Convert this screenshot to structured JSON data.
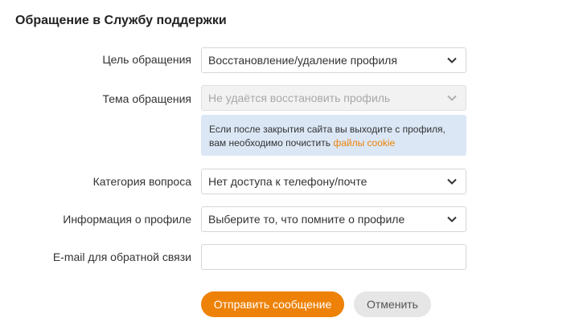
{
  "page": {
    "title": "Обращение в Службу поддержки"
  },
  "form": {
    "purpose": {
      "label": "Цель обращения",
      "value": "Восстановление/удаление профиля"
    },
    "topic": {
      "label": "Тема обращения",
      "value": "Не удаётся восстановить профиль"
    },
    "info": {
      "line1": "Если после закрытия сайта вы выходите с профиля,",
      "line2_prefix": "вам необходимо почистить ",
      "link_text": "файлы cookie"
    },
    "category": {
      "label": "Категория вопроса",
      "value": "Нет доступа к телефону/почте"
    },
    "profile_info": {
      "label": "Информация о профиле",
      "value": "Выберите то, что помните о профиле"
    },
    "email": {
      "label": "E-mail для обратной связи",
      "value": ""
    }
  },
  "buttons": {
    "submit_label": "Отправить сообщение",
    "cancel_label": "Отменить"
  },
  "icons": {
    "select_arrow": "chevron-down-icon"
  },
  "colors": {
    "accent": "#ee8208",
    "info_bg": "#dbe7f5",
    "cancel_bg": "#e6e6e6"
  }
}
